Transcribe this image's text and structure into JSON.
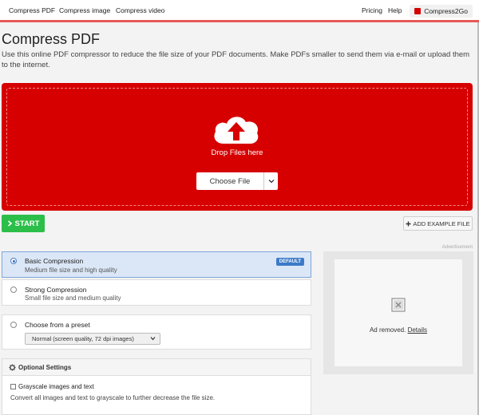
{
  "nav": {
    "links": [
      "Compress PDF",
      "Compress image",
      "Compress video"
    ],
    "pricing": "Pricing",
    "help": "Help",
    "brand": "Compress2Go"
  },
  "page": {
    "title": "Compress PDF",
    "description": "Use this online PDF compressor to reduce the file size of your PDF documents. Make PDFs smaller to send them via e-mail or upload them to the internet."
  },
  "dropzone": {
    "drop_text": "Drop Files here",
    "choose_label": "Choose File",
    "icon": "cloud-upload-icon",
    "color": "#d70000"
  },
  "actions": {
    "start_label": "START",
    "example_label": "ADD EXAMPLE FILE"
  },
  "options": {
    "basic": {
      "title": "Basic Compression",
      "subtitle": "Medium file size and high quality",
      "badge": "DEFAULT",
      "selected": true
    },
    "strong": {
      "title": "Strong Compression",
      "subtitle": "Small file size and medium quality",
      "selected": false
    },
    "preset": {
      "title": "Choose from a preset",
      "selected_value": "Normal (screen quality, 72 dpi images)"
    }
  },
  "optional": {
    "heading": "Optional Settings",
    "grayscale_label": "Grayscale images and text",
    "grayscale_desc": "Convert all images and text to grayscale to further decrease the file size."
  },
  "ad": {
    "label": "Advertisement",
    "removed_text": "Ad removed.",
    "details_link": "Details"
  }
}
